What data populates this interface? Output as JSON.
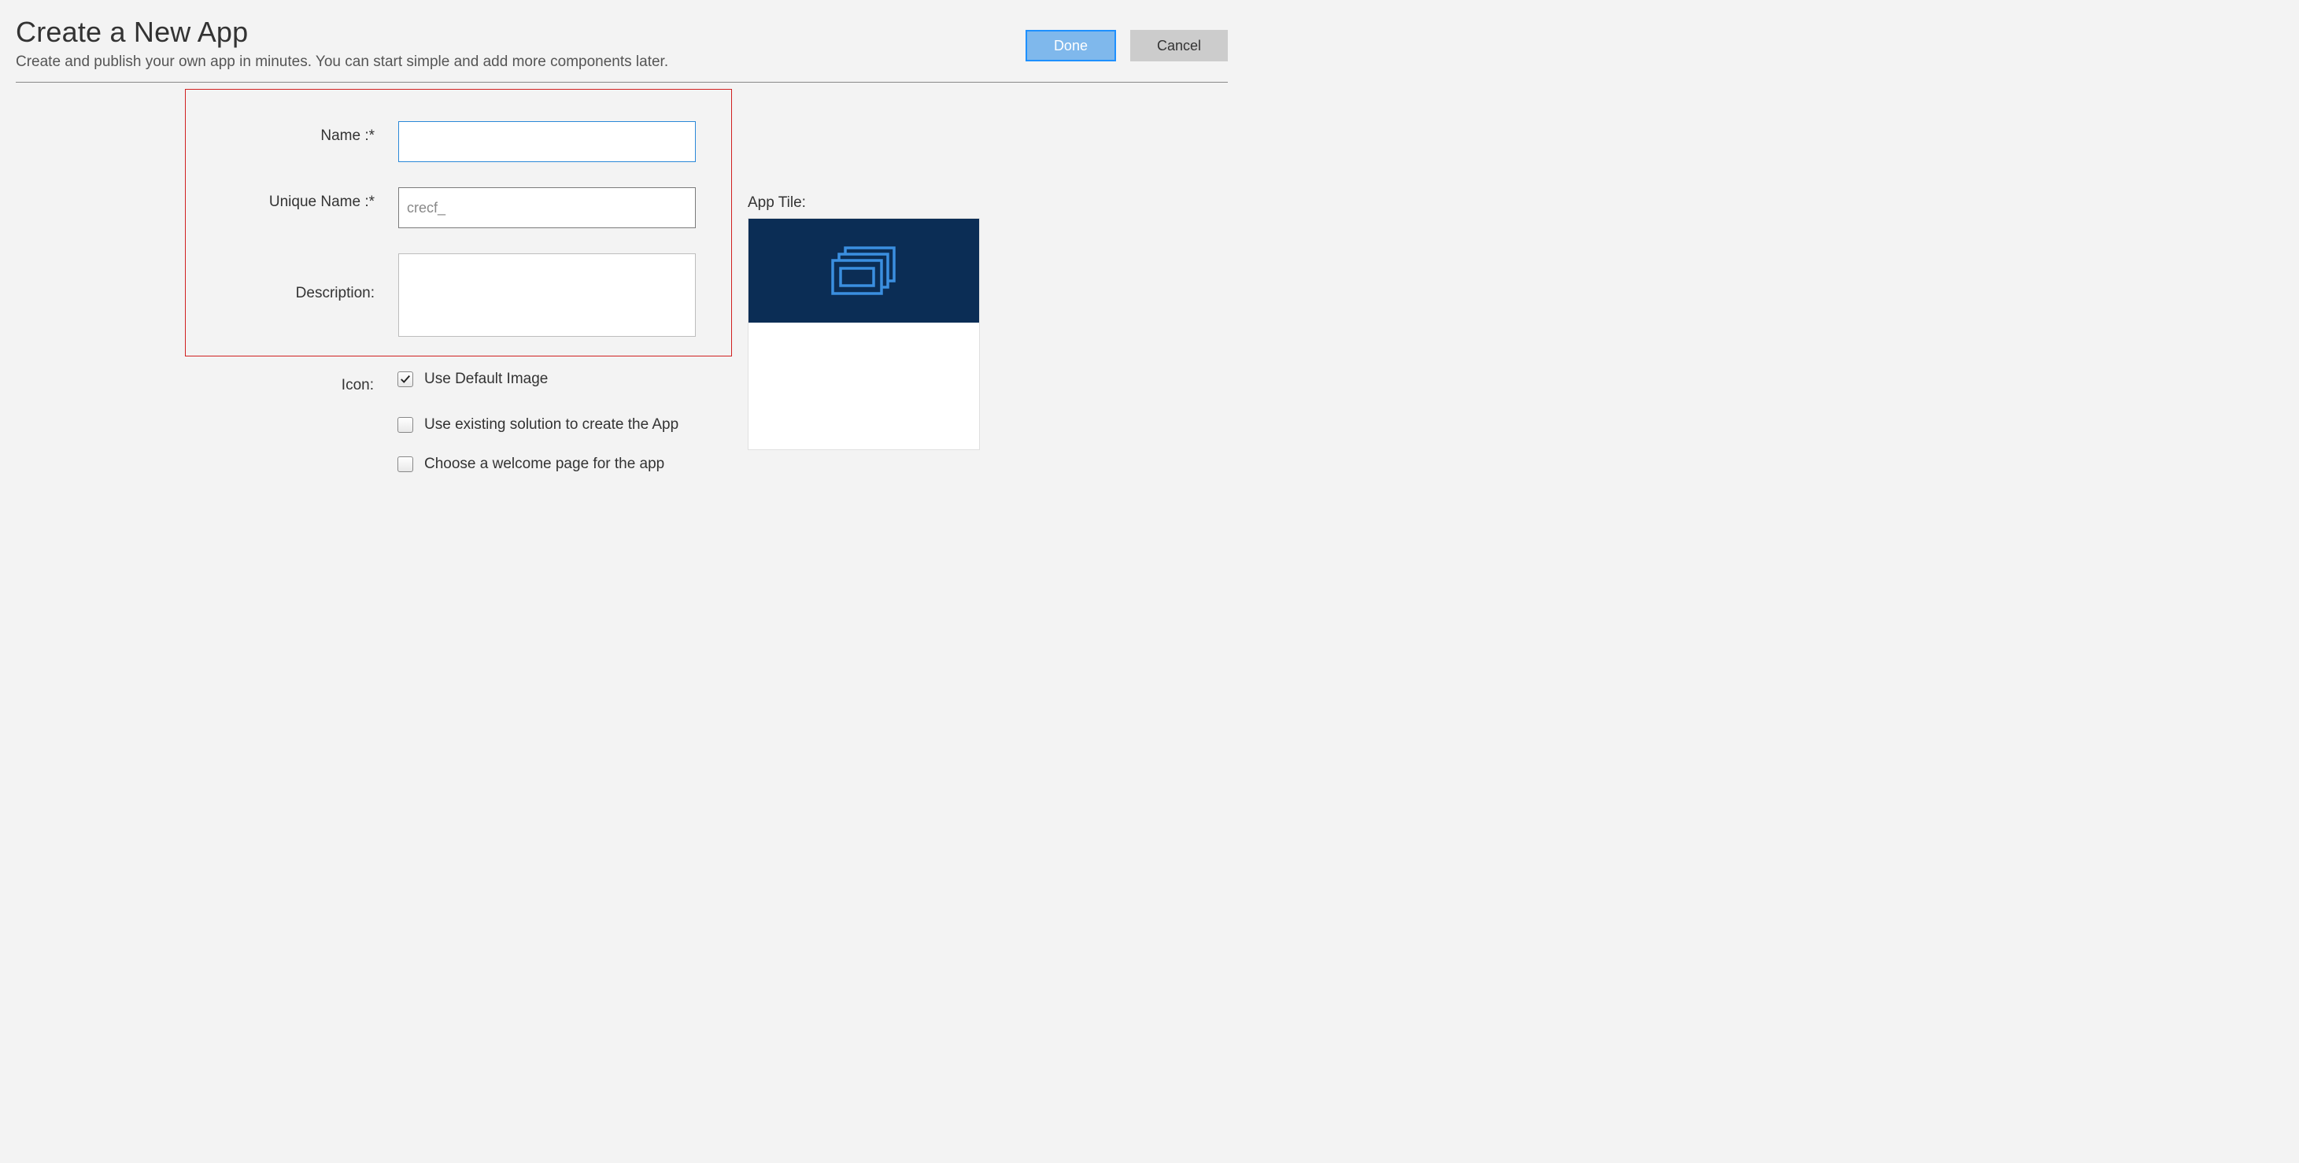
{
  "header": {
    "title": "Create a New App",
    "subtitle": "Create and publish your own app in minutes. You can start simple and add more components later.",
    "done_label": "Done",
    "cancel_label": "Cancel"
  },
  "form": {
    "name_label": "Name :*",
    "name_value": "",
    "unique_name_label": "Unique Name :*",
    "unique_name_value": "crecf_",
    "description_label": "Description:",
    "description_value": "",
    "icon_label": "Icon:",
    "use_default_image_label": "Use Default Image",
    "use_default_image_checked": true,
    "use_existing_solution_label": "Use existing solution to create the App",
    "use_existing_solution_checked": false,
    "choose_welcome_page_label": "Choose a welcome page for the app",
    "choose_welcome_page_checked": false
  },
  "tile": {
    "label": "App Tile:",
    "icon_name": "app-tile-icon",
    "header_color": "#0b2d55",
    "icon_color": "#3b8fe0"
  }
}
